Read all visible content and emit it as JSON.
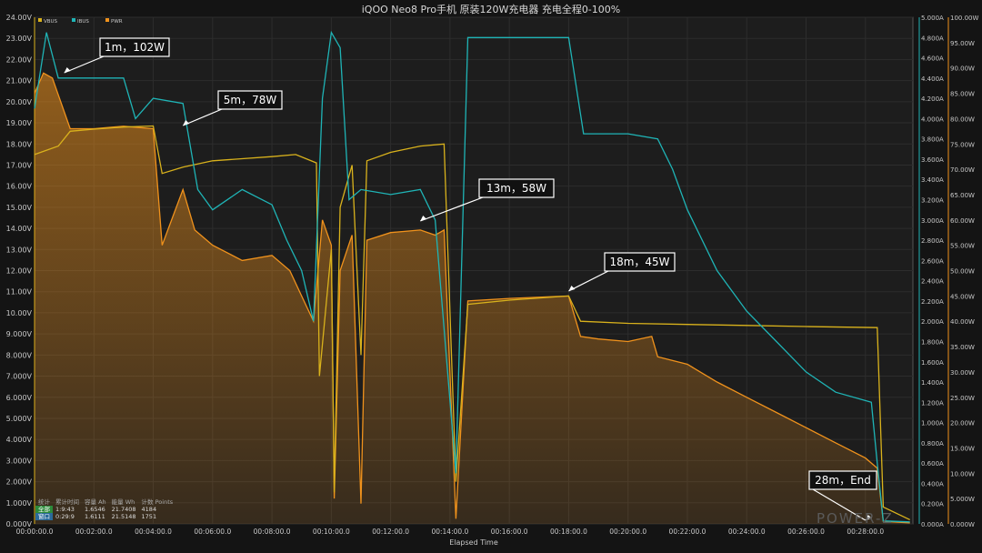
{
  "chart_data": {
    "type": "line",
    "title": "iQOO Neo8  Pro手机 原装120W充电器 充电全程0-100%",
    "xlabel": "Elapsed Time",
    "x_ticks": [
      "00:00:00.0",
      "00:02:00.0",
      "00:04:00.0",
      "00:06:00.0",
      "00:08:00.0",
      "00:10:00.0",
      "00:12:00.0",
      "00:14:00.0",
      "00:16:00.0",
      "00:18:00.0",
      "00:20:00.0",
      "00:22:00.0",
      "00:24:00.0",
      "00:26:00.0",
      "00:28:00.0"
    ],
    "xlim_min": [
      0,
      29.6
    ],
    "left_axis": {
      "unit": "V",
      "ylim": [
        0,
        24
      ],
      "ticks": [
        "0.000V",
        "1.000V",
        "2.000V",
        "3.000V",
        "4.000V",
        "5.000V",
        "6.000V",
        "7.000V",
        "8.000V",
        "9.000V",
        "10.00V",
        "11.00V",
        "12.00V",
        "13.00V",
        "14.00V",
        "15.00V",
        "16.00V",
        "17.00V",
        "18.00V",
        "19.00V",
        "20.00V",
        "21.00V",
        "22.00V",
        "23.00V",
        "24.00V"
      ]
    },
    "mid_axis": {
      "unit": "A",
      "ylim": [
        0,
        5
      ],
      "ticks": [
        "0.000A",
        "0.200A",
        "0.400A",
        "0.600A",
        "0.800A",
        "1.000A",
        "1.200A",
        "1.400A",
        "1.600A",
        "1.800A",
        "2.000A",
        "2.200A",
        "2.400A",
        "2.600A",
        "2.800A",
        "3.000A",
        "3.200A",
        "3.400A",
        "3.600A",
        "3.800A",
        "4.000A",
        "4.200A",
        "4.400A",
        "4.600A",
        "4.800A",
        "5.000A"
      ]
    },
    "right_axis": {
      "unit": "W",
      "ylim": [
        0,
        100
      ],
      "ticks": [
        "0.000W",
        "5.000W",
        "10.00W",
        "15.00W",
        "20.00W",
        "25.00W",
        "30.00W",
        "35.00W",
        "40.00W",
        "45.00W",
        "50.00W",
        "55.00W",
        "60.00W",
        "65.00W",
        "70.00W",
        "75.00W",
        "80.00W",
        "85.00W",
        "90.00W",
        "95.00W",
        "100.00W"
      ]
    },
    "legend": {
      "placement": "top-left",
      "items": [
        {
          "name": "VBUS",
          "color": "#d9b21c"
        },
        {
          "name": "IBUS",
          "color": "#1fb4b6"
        },
        {
          "name": "PWR",
          "color": "#f0921c"
        }
      ]
    },
    "series": [
      {
        "name": "VBUS",
        "axis": "left",
        "color": "#d9b21c",
        "points": [
          [
            0,
            17.5
          ],
          [
            0.8,
            17.9
          ],
          [
            1.2,
            18.6
          ],
          [
            2,
            18.7
          ],
          [
            3,
            18.8
          ],
          [
            4,
            18.85
          ],
          [
            4.3,
            16.6
          ],
          [
            5,
            16.9
          ],
          [
            6,
            17.2
          ],
          [
            7,
            17.3
          ],
          [
            8,
            17.4
          ],
          [
            8.8,
            17.5
          ],
          [
            9.5,
            17.1
          ],
          [
            9.6,
            7
          ],
          [
            10,
            13
          ],
          [
            10.1,
            1.5
          ],
          [
            10.3,
            15
          ],
          [
            10.7,
            17.0
          ],
          [
            11,
            8
          ],
          [
            11.2,
            17.2
          ],
          [
            12,
            17.6
          ],
          [
            13,
            17.9
          ],
          [
            13.8,
            18.0
          ],
          [
            14.2,
            2
          ],
          [
            14.6,
            10.4
          ],
          [
            16,
            10.6
          ],
          [
            18,
            10.8
          ],
          [
            18.4,
            9.6
          ],
          [
            20,
            9.5
          ],
          [
            22,
            9.45
          ],
          [
            24,
            9.4
          ],
          [
            26,
            9.35
          ],
          [
            28.4,
            9.3
          ],
          [
            28.6,
            0.8
          ],
          [
            29.5,
            0.2
          ]
        ]
      },
      {
        "name": "IBUS",
        "axis": "mid",
        "color": "#1fb4b6",
        "points": [
          [
            0,
            4.1
          ],
          [
            0.4,
            4.85
          ],
          [
            0.8,
            4.4
          ],
          [
            1.2,
            4.4
          ],
          [
            2,
            4.4
          ],
          [
            3,
            4.4
          ],
          [
            3.4,
            4.0
          ],
          [
            4,
            4.2
          ],
          [
            5,
            4.15
          ],
          [
            5.5,
            3.3
          ],
          [
            6,
            3.1
          ],
          [
            7,
            3.3
          ],
          [
            8,
            3.15
          ],
          [
            8.5,
            2.8
          ],
          [
            9,
            2.5
          ],
          [
            9.4,
            2.0
          ],
          [
            9.7,
            4.2
          ],
          [
            10,
            4.85
          ],
          [
            10.3,
            4.7
          ],
          [
            10.6,
            3.2
          ],
          [
            11,
            3.3
          ],
          [
            12,
            3.25
          ],
          [
            13,
            3.3
          ],
          [
            13.5,
            3.0
          ],
          [
            14.2,
            0.5
          ],
          [
            14.6,
            4.8
          ],
          [
            16,
            4.8
          ],
          [
            18,
            4.8
          ],
          [
            18.5,
            3.85
          ],
          [
            20,
            3.85
          ],
          [
            21,
            3.8
          ],
          [
            21.5,
            3.5
          ],
          [
            22,
            3.1
          ],
          [
            23,
            2.5
          ],
          [
            24,
            2.1
          ],
          [
            25,
            1.8
          ],
          [
            26,
            1.5
          ],
          [
            27,
            1.3
          ],
          [
            28.2,
            1.2
          ],
          [
            28.4,
            0.6
          ],
          [
            28.6,
            0.03
          ],
          [
            29.5,
            0.02
          ]
        ]
      },
      {
        "name": "PWR",
        "axis": "right",
        "color": "#f0921c",
        "points": [
          [
            0,
            85
          ],
          [
            0.3,
            89
          ],
          [
            0.6,
            88
          ],
          [
            1.2,
            78
          ],
          [
            2,
            78
          ],
          [
            3,
            78.5
          ],
          [
            4,
            78
          ],
          [
            4.3,
            55
          ],
          [
            5,
            66
          ],
          [
            5.4,
            58
          ],
          [
            6,
            55
          ],
          [
            7,
            52
          ],
          [
            8,
            53
          ],
          [
            8.6,
            50
          ],
          [
            9,
            45
          ],
          [
            9.4,
            40
          ],
          [
            9.7,
            60
          ],
          [
            10.0,
            55
          ],
          [
            10.1,
            5
          ],
          [
            10.3,
            50
          ],
          [
            10.7,
            57
          ],
          [
            11,
            4
          ],
          [
            11.2,
            56
          ],
          [
            12,
            57.5
          ],
          [
            13,
            58
          ],
          [
            13.5,
            57
          ],
          [
            13.8,
            58
          ],
          [
            14.2,
            1
          ],
          [
            14.6,
            44
          ],
          [
            16,
            44.5
          ],
          [
            18,
            45
          ],
          [
            18.4,
            37
          ],
          [
            19,
            36.5
          ],
          [
            20,
            36
          ],
          [
            20.8,
            37
          ],
          [
            21,
            33
          ],
          [
            22,
            31.5
          ],
          [
            23,
            28
          ],
          [
            24,
            25
          ],
          [
            25,
            22
          ],
          [
            26,
            19
          ],
          [
            27,
            16
          ],
          [
            28,
            13
          ],
          [
            28.4,
            11
          ],
          [
            28.6,
            0.5
          ],
          [
            29.5,
            0.2
          ]
        ]
      }
    ],
    "annotations": [
      {
        "text": "1m，102W",
        "x": 1.0
      },
      {
        "text": "5m，78W",
        "x": 5.0
      },
      {
        "text": "13m，58W",
        "x": 13.0
      },
      {
        "text": "18m，45W",
        "x": 18.0
      },
      {
        "text": "28m，End",
        "x": 28.0
      }
    ]
  },
  "stats": {
    "headers": [
      "统计",
      "累计时间",
      "容量 Ah",
      "能量 Wh",
      "计数 Points"
    ],
    "rows": [
      [
        "全部",
        "1:9:43",
        "1.6546",
        "21.7408",
        "4184"
      ],
      [
        "窗口",
        "0:29:9",
        "1.6111",
        "21.5148",
        "1751"
      ]
    ]
  },
  "watermark": "POWER-Z"
}
